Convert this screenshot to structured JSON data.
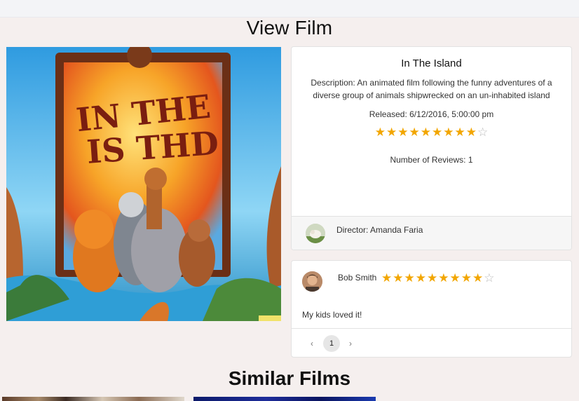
{
  "page_title": "View Film",
  "film": {
    "title": "In The Island",
    "description": "Description: An animated film following the funny adventures of a diverse group of animals shipwrecked on an un-inhabited island",
    "released": "Released: 6/12/2016, 5:00:00 pm",
    "rating": 9,
    "rating_max": 10,
    "reviews_count": "Number of Reviews: 1",
    "director": "Director: Amanda Faria"
  },
  "review": {
    "author": "Bob Smith",
    "rating": 9,
    "rating_max": 10,
    "text": "My kids loved it!"
  },
  "pagination": {
    "prev": "‹",
    "current": "1",
    "next": "›"
  },
  "similar_title": "Similar Films",
  "colors": {
    "star_filled": "#f2a600",
    "star_empty": "#b9b9b9",
    "page_background": "#f5efee"
  }
}
